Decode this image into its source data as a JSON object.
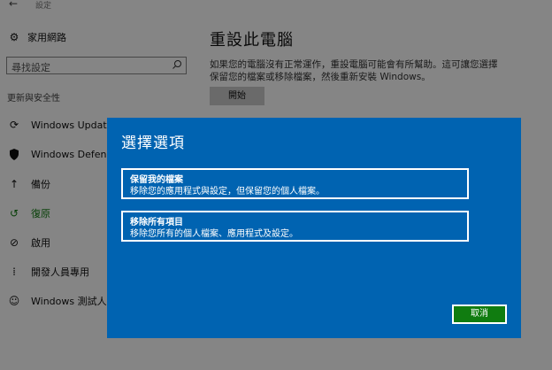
{
  "window": {
    "title": "設定",
    "back_icon": "back-arrow-icon"
  },
  "nav": {
    "home": {
      "label": "家用網路",
      "icon": "gear-icon"
    },
    "search": {
      "placeholder": "尋找設定",
      "icon": "search-icon"
    },
    "section_header": "更新與安全性",
    "items": [
      {
        "label": "Windows Update",
        "icon": "refresh-icon"
      },
      {
        "label": "Windows Defender",
        "icon": "shield-icon"
      },
      {
        "label": "備份",
        "icon": "backup-arrow-icon"
      },
      {
        "label": "復原",
        "icon": "recovery-icon",
        "active": true
      },
      {
        "label": "啟用",
        "icon": "activation-icon"
      },
      {
        "label": "開發人員專用",
        "icon": "developer-icon"
      },
      {
        "label": "Windows 測試人員",
        "icon": "insider-icon"
      }
    ]
  },
  "main": {
    "title": "重設此電腦",
    "description": "如果您的電腦沒有正常運作，重設電腦可能會有所幫助。這可讓您選擇保留您的檔案或移除檔案，然後重新安裝 Windows。",
    "start_button": "開始"
  },
  "dialog": {
    "title": "選擇選項",
    "options": [
      {
        "title": "保留我的檔案",
        "description": "移除您的應用程式與設定，但保留您的個人檔案。"
      },
      {
        "title": "移除所有項目",
        "description": "移除您所有的個人檔案、應用程式及設定。"
      }
    ],
    "cancel": "取消"
  },
  "colors": {
    "dialog_bg": "#0063b1",
    "accent_green": "#107c10",
    "overlay": "rgba(0,0,0,0.48)"
  }
}
